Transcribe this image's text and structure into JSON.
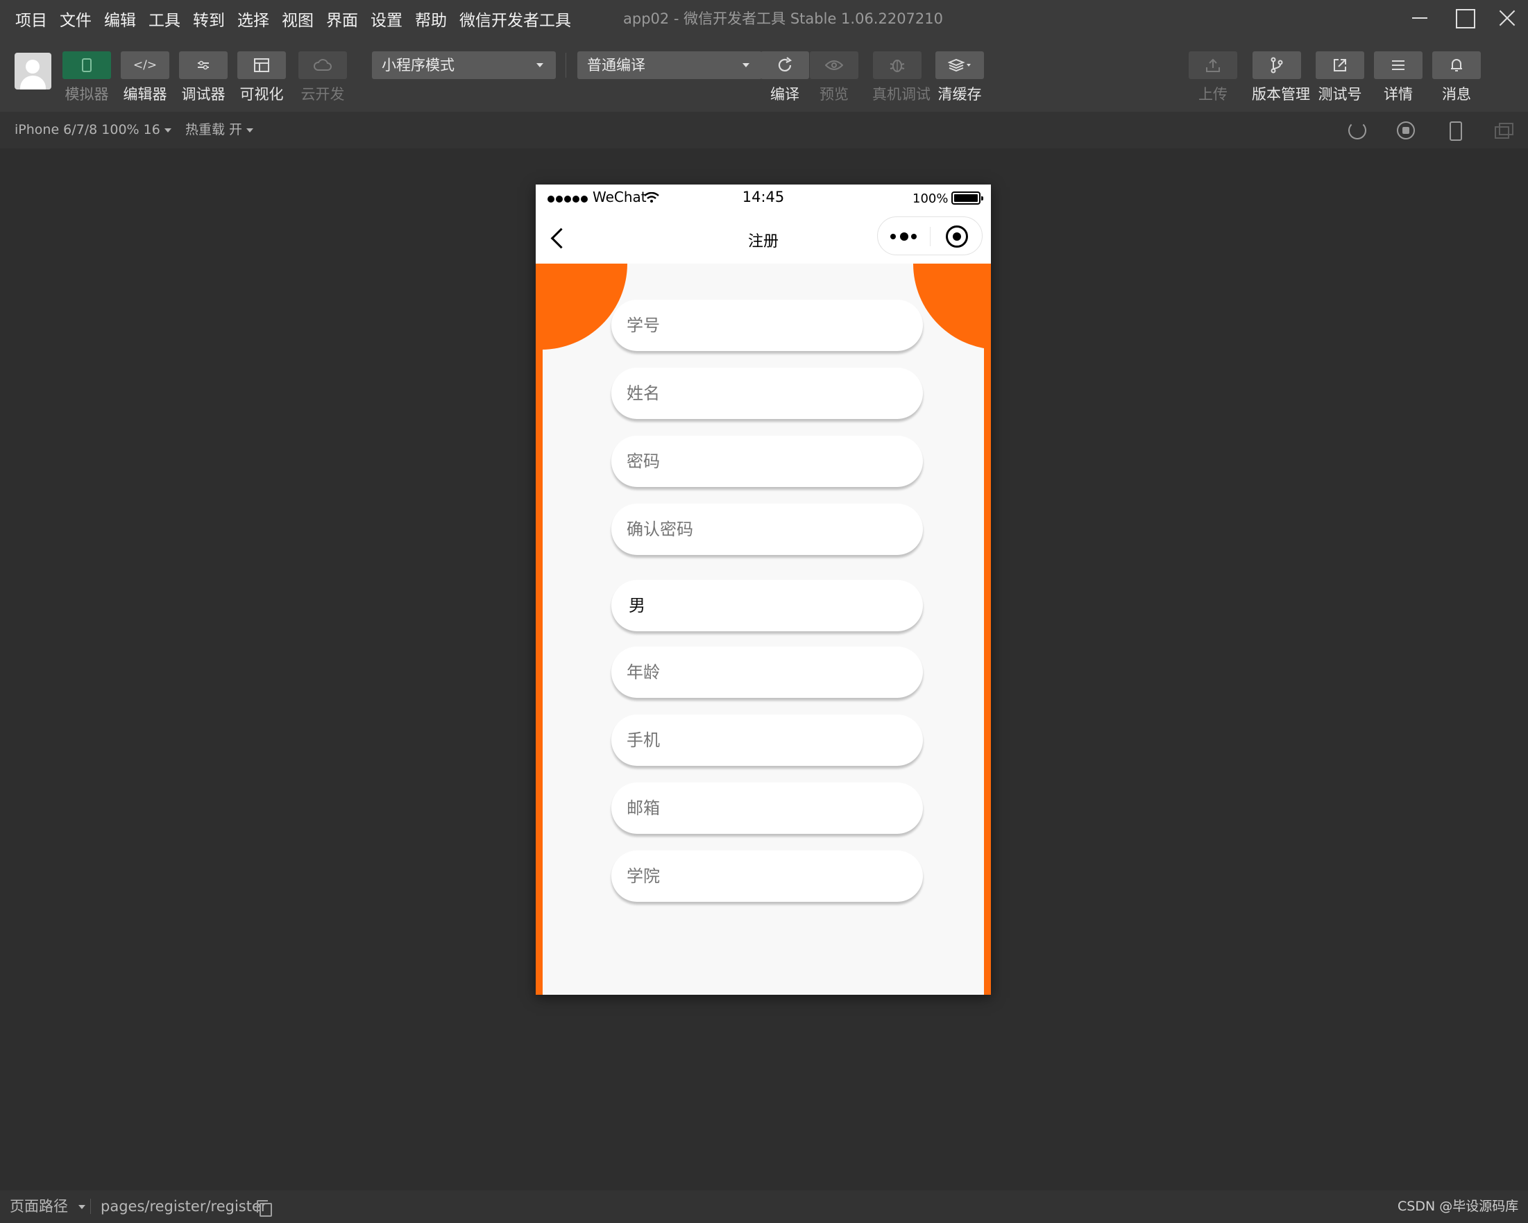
{
  "menubar": {
    "items": [
      "项目",
      "文件",
      "编辑",
      "工具",
      "转到",
      "选择",
      "视图",
      "界面",
      "设置",
      "帮助",
      "微信开发者工具"
    ],
    "window_title": "app02 - 微信开发者工具 Stable 1.06.2207210"
  },
  "toolbar": {
    "simulator": "模拟器",
    "editor": "编辑器",
    "debugger": "调试器",
    "visual": "可视化",
    "cloud": "云开发",
    "mode_select": "小程序模式",
    "compile_select": "普通编译",
    "compile": "编译",
    "preview": "预览",
    "remote_debug": "真机调试",
    "clear_cache": "清缓存",
    "upload": "上传",
    "version": "版本管理",
    "test_account": "测试号",
    "details": "详情",
    "messages": "消息"
  },
  "devicebar": {
    "device": "iPhone 6/7/8 100% 16",
    "hot_reload": "热重载 开"
  },
  "phone": {
    "status": {
      "carrier": "WeChat",
      "time": "14:45",
      "battery": "100%"
    },
    "nav_title": "注册",
    "form": {
      "student_id_placeholder": "学号",
      "name_placeholder": "姓名",
      "password_placeholder": "密码",
      "confirm_password_placeholder": "确认密码",
      "gender_value": "男",
      "age_placeholder": "年龄",
      "phone_placeholder": "手机",
      "email_placeholder": "邮箱",
      "college_placeholder": "学院"
    },
    "accent_color": "#ff6a0a"
  },
  "bottombar": {
    "page_path_label": "页面路径",
    "page_path": "pages/register/register",
    "watermark": "CSDN @毕设源码库"
  }
}
